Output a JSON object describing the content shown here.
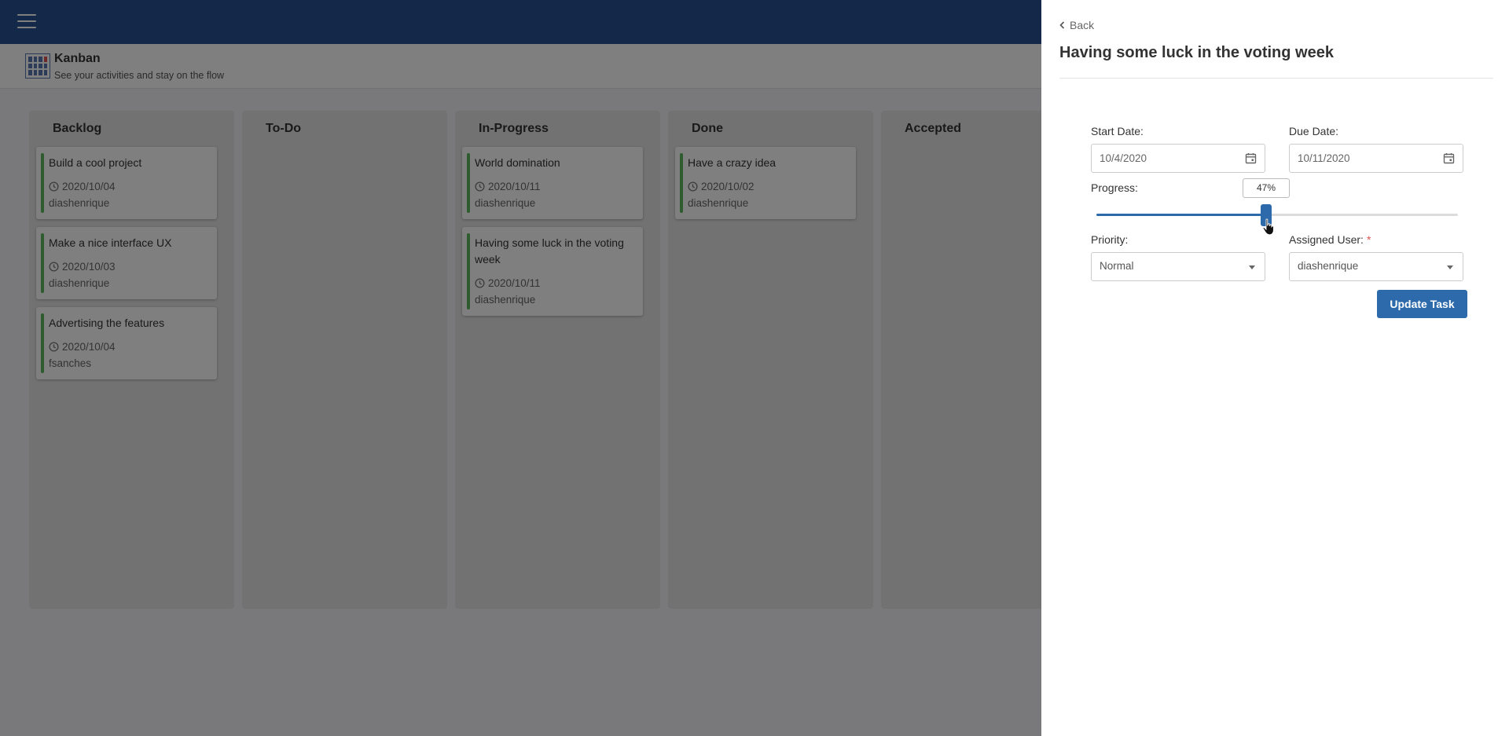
{
  "app": {
    "title": "Kanban",
    "subtitle": "See your activities and stay on the flow",
    "colors": {
      "topbar": "#285094",
      "accent": "#2d6aab",
      "card_stripe": "#5cb85c"
    }
  },
  "board": {
    "columns": [
      {
        "title": "Backlog",
        "cards": [
          {
            "title": "Build a cool project",
            "date": "2020/10/04",
            "user": "diashenrique"
          },
          {
            "title": "Make a nice interface UX",
            "date": "2020/10/03",
            "user": "diashenrique"
          },
          {
            "title": "Advertising the features",
            "date": "2020/10/04",
            "user": "fsanches"
          }
        ]
      },
      {
        "title": "To-Do",
        "cards": []
      },
      {
        "title": "In-Progress",
        "cards": [
          {
            "title": "World domination",
            "date": "2020/10/11",
            "user": "diashenrique"
          },
          {
            "title": "Having some luck in the voting week",
            "date": "2020/10/11",
            "user": "diashenrique"
          }
        ]
      },
      {
        "title": "Done",
        "cards": [
          {
            "title": "Have a crazy idea",
            "date": "2020/10/02",
            "user": "diashenrique"
          }
        ]
      },
      {
        "title": "Accepted",
        "cards": []
      }
    ]
  },
  "panel": {
    "back_label": "Back",
    "title": "Having some luck in the voting week",
    "start_date": {
      "label": "Start Date:",
      "value": "10/4/2020"
    },
    "due_date": {
      "label": "Due Date:",
      "value": "10/11/2020"
    },
    "progress": {
      "label": "Progress:",
      "value": 47,
      "display": "47%"
    },
    "priority": {
      "label": "Priority:",
      "value": "Normal"
    },
    "assigned_user": {
      "label": "Assigned User:",
      "required_mark": "*",
      "value": "diashenrique"
    },
    "submit_label": "Update Task"
  }
}
